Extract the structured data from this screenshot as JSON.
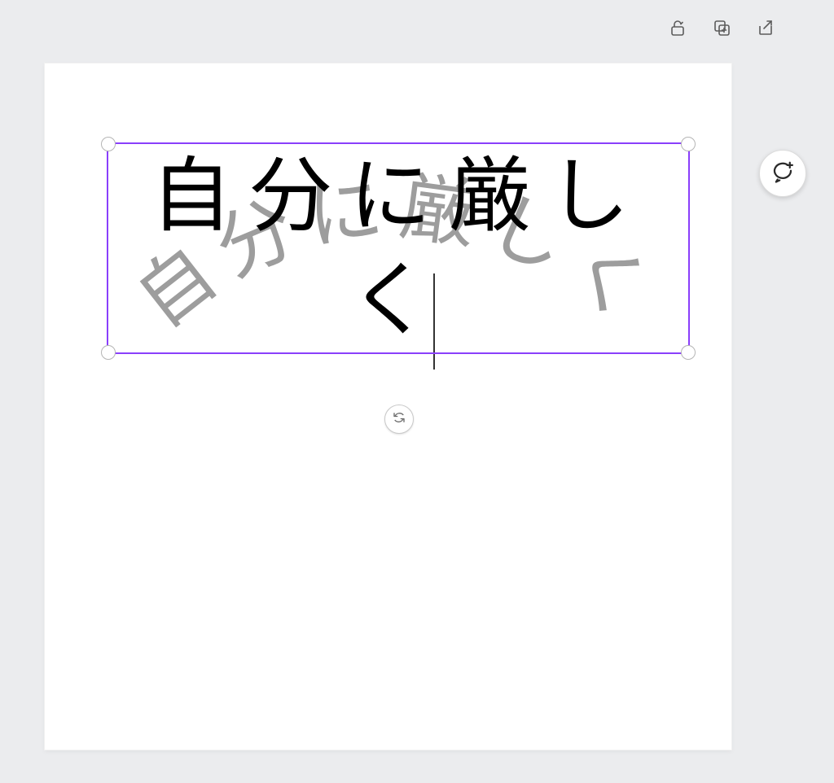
{
  "toolbar": {
    "icons": {
      "lock": "unlock-icon",
      "duplicate": "duplicate-plus-icon",
      "share": "share-icon"
    }
  },
  "canvas": {
    "editing_text": "自分に厳しく",
    "ghost_text": "自分に厳しく",
    "selection_color": "#8a3ffb"
  },
  "controls": {
    "rotate_label": "rotate",
    "comment_label": "add-comment"
  }
}
